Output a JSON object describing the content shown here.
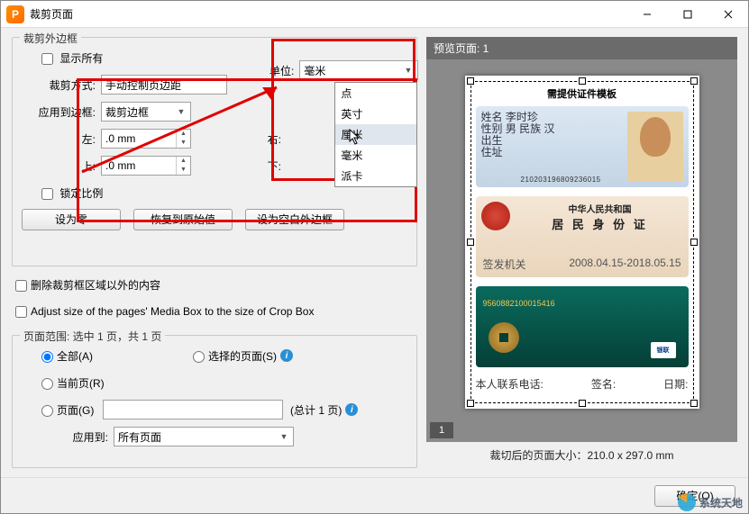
{
  "window": {
    "title": "裁剪页面"
  },
  "titlebar_icon_letter": "P",
  "group_outer": {
    "title": "裁剪外边框",
    "show_all_label": "显示所有",
    "unit_label": "单位:",
    "unit_value": "毫米",
    "unit_options": [
      "点",
      "英寸",
      "厘米",
      "毫米",
      "派卡"
    ],
    "crop_method_label": "裁剪方式:",
    "crop_method_value": "手动控制页边距",
    "apply_border_label": "应用到边框:",
    "apply_border_value": "裁剪边框",
    "left_label": "左:",
    "left_value": ".0 mm",
    "right_label": "右:",
    "top_label": "上:",
    "top_value": ".0 mm",
    "bottom_label": "下:",
    "lock_ratio_label": "锁定比例",
    "btn_zero": "设为零",
    "btn_restore": "恢复到原始值",
    "btn_blank": "设为空白外边框"
  },
  "remove_outside_label": "删除裁剪框区域以外的内容",
  "adjust_media_label": "Adjust size of the pages' Media Box to the size of Crop Box",
  "group_range": {
    "title": "页面范围: 选中 1 页，共 1 页",
    "all_label": "全部(A)",
    "selected_label": "选择的页面(S)",
    "current_label": "当前页(R)",
    "page_label": "页面(G)",
    "page_total": "(总计 1 页)",
    "apply_to_label": "应用到:",
    "apply_to_value": "所有页面"
  },
  "preview": {
    "header": "预览页面: 1",
    "page_tab": "1",
    "footer": "裁切后的页面大小：210.0 x 297.0 mm",
    "doc_title": "需提供证件模板",
    "card1_lines": [
      "姓名  李时珍",
      "性别 男  民族 汉",
      "出生",
      "住址"
    ],
    "card1_number": "210203196809236015",
    "card2_line1": "中华人民共和国",
    "card2_line2": "居 民 身 份 证",
    "card2_btm_left": "签发机关",
    "card2_btm_right": "2008.04.15-2018.05.15",
    "card3_number": "9560882100015416",
    "card3_badge": "银联",
    "footrow": [
      "本人联系电话:",
      "签名:",
      "日期:"
    ]
  },
  "footer": {
    "ok": "确定(O)"
  },
  "watermark": "系统天地"
}
